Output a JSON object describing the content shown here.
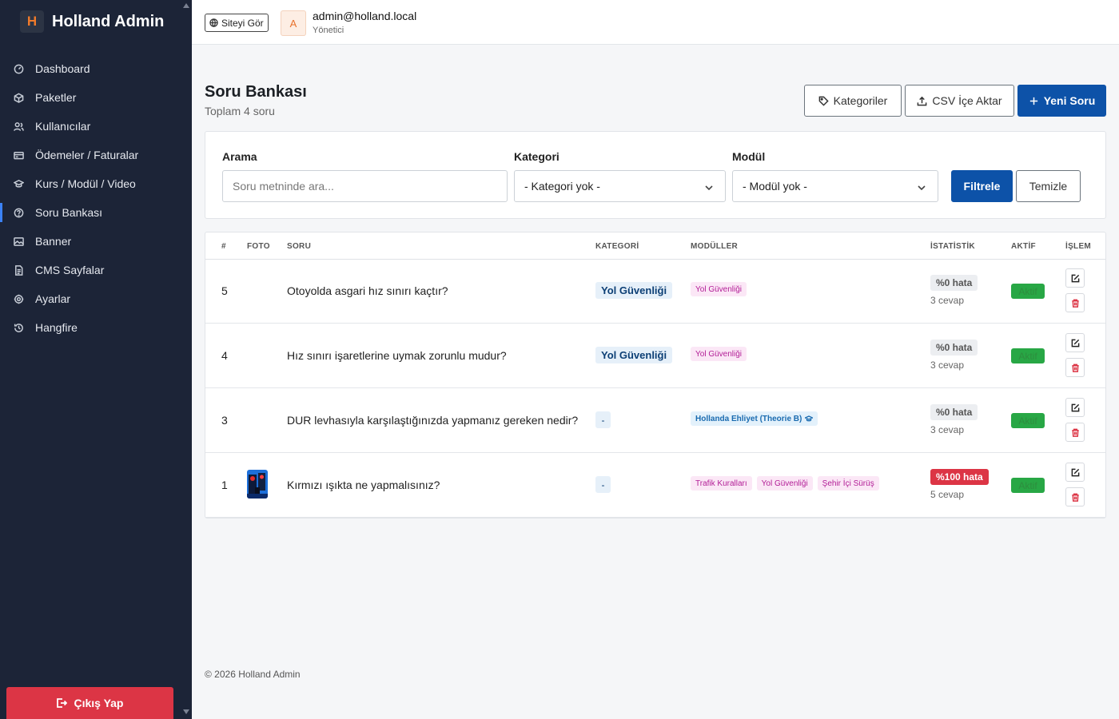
{
  "brand": {
    "logo_letter": "H",
    "name": "Holland Admin"
  },
  "sidebar": {
    "items": [
      {
        "label": "Dashboard",
        "icon": "dashboard-icon"
      },
      {
        "label": "Paketler",
        "icon": "box-icon"
      },
      {
        "label": "Kullanıcılar",
        "icon": "users-icon"
      },
      {
        "label": "Ödemeler / Faturalar",
        "icon": "credit-card-icon"
      },
      {
        "label": "Kurs / Modül / Video",
        "icon": "graduation-cap-icon"
      },
      {
        "label": "Soru Bankası",
        "icon": "question-icon"
      },
      {
        "label": "Banner",
        "icon": "image-icon"
      },
      {
        "label": "CMS Sayfalar",
        "icon": "file-text-icon"
      },
      {
        "label": "Ayarlar",
        "icon": "gear-icon"
      },
      {
        "label": "Hangfire",
        "icon": "history-icon"
      }
    ],
    "active_index": 5,
    "logout_label": "Çıkış Yap"
  },
  "topbar": {
    "site_button": "Siteyi Gör",
    "avatar_letter": "A",
    "user_email": "admin@holland.local",
    "user_role": "Yönetici"
  },
  "page": {
    "title": "Soru Bankası",
    "subtitle": "Toplam 4 soru",
    "btn_categories": "Kategoriler",
    "btn_csv": "CSV İçe Aktar",
    "btn_new": "Yeni Soru"
  },
  "filters": {
    "search_label": "Arama",
    "search_placeholder": "Soru metninde ara...",
    "category_label": "Kategori",
    "category_value": "- Kategori yok -",
    "module_label": "Modül",
    "module_value": "- Modül yok -",
    "filter_button": "Filtrele",
    "clear_button": "Temizle"
  },
  "table": {
    "headers": [
      "#",
      "FOTO",
      "SORU",
      "KATEGORİ",
      "MODÜLLER",
      "İSTATİSTİK",
      "AKTİF",
      "İŞLEM"
    ],
    "rows": [
      {
        "id": "5",
        "has_photo": false,
        "question": "Otoyolda asgari hız sınırı kaçtır?",
        "category": "Yol Güvenliği",
        "modules": [
          {
            "label": "Yol Güvenliği",
            "style": "pink"
          }
        ],
        "stat": "%0 hata",
        "stat_style": "gray",
        "answers": "3 cevap",
        "active": "Aktif"
      },
      {
        "id": "4",
        "has_photo": false,
        "question": "Hız sınırı işaretlerine uymak zorunlu mudur?",
        "category": "Yol Güvenliği",
        "modules": [
          {
            "label": "Yol Güvenliği",
            "style": "pink"
          }
        ],
        "stat": "%0 hata",
        "stat_style": "gray",
        "answers": "3 cevap",
        "active": "Aktif"
      },
      {
        "id": "3",
        "has_photo": false,
        "question": "DUR levhasıyla karşılaştığınızda yapmanız gereken nedir?",
        "category": "-",
        "modules": [
          {
            "label": "Hollanda Ehliyet (Theorie B)",
            "style": "blue"
          }
        ],
        "stat": "%0 hata",
        "stat_style": "gray",
        "answers": "3 cevap",
        "active": "Aktif"
      },
      {
        "id": "1",
        "has_photo": true,
        "question": "Kırmızı ışıkta ne yapmalısınız?",
        "category": "-",
        "modules": [
          {
            "label": "Trafik Kuralları",
            "style": "pink"
          },
          {
            "label": "Yol Güvenliği",
            "style": "pink"
          },
          {
            "label": "Şehir İçi Sürüş",
            "style": "pink"
          }
        ],
        "stat": "%100 hata",
        "stat_style": "red",
        "answers": "5 cevap",
        "active": "Aktif"
      }
    ]
  },
  "footer": "© 2026 Holland Admin",
  "colors": {
    "sidebar_bg": "#1c2437",
    "primary": "#0d52a8",
    "danger": "#dc3545",
    "success": "#28a745",
    "brand_accent": "#f07a2a"
  }
}
